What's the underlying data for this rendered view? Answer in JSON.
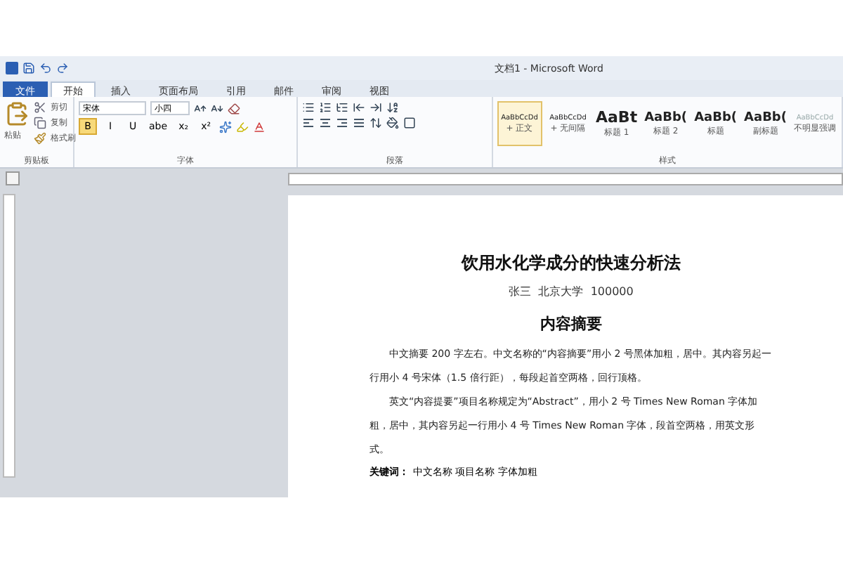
{
  "window": {
    "title": "文档1 - Microsoft Word"
  },
  "tabs": [
    {
      "label": "文件",
      "kind": "file",
      "selected": false
    },
    {
      "label": "开始",
      "kind": "tab",
      "selected": true
    },
    {
      "label": "插入",
      "kind": "tab",
      "selected": false
    },
    {
      "label": "页面布局",
      "kind": "tab",
      "selected": false
    },
    {
      "label": "引用",
      "kind": "tab",
      "selected": false
    },
    {
      "label": "邮件",
      "kind": "tab",
      "selected": false
    },
    {
      "label": "审阅",
      "kind": "tab",
      "selected": false
    },
    {
      "label": "视图",
      "kind": "tab",
      "selected": false
    }
  ],
  "clipboard": {
    "paste": "粘贴",
    "cut": "剪切",
    "copy": "复制",
    "format_painter": "格式刷",
    "group": "剪贴板"
  },
  "font": {
    "name": "宋体",
    "size": "小四",
    "group": "字体",
    "buttons": [
      {
        "label": "B",
        "selected": true
      },
      {
        "label": "I",
        "selected": false
      },
      {
        "label": "U",
        "selected": false
      },
      {
        "label": "abe",
        "selected": false
      },
      {
        "label": "x₂",
        "selected": false
      },
      {
        "label": "x²",
        "selected": false
      }
    ]
  },
  "paragraph": {
    "group": "段落"
  },
  "styles": {
    "group": "样式",
    "items": [
      {
        "sample": "AaBbCcDd",
        "label": "+ 正文",
        "kind": "small",
        "selected": true
      },
      {
        "sample": "AaBbCcDd",
        "label": "+ 无间隔",
        "kind": "small",
        "selected": false
      },
      {
        "sample": "AaBt",
        "label": "标题 1",
        "kind": "h1",
        "selected": false
      },
      {
        "sample": "AaBb(",
        "label": "标题 2",
        "kind": "h2",
        "selected": false
      },
      {
        "sample": "AaBb(",
        "label": "标题",
        "kind": "h2",
        "selected": false
      },
      {
        "sample": "AaBb(",
        "label": "副标题",
        "kind": "h2",
        "selected": false
      },
      {
        "sample": "AaBbCcDd",
        "label": "不明显强调",
        "kind": "faint",
        "selected": false
      }
    ]
  },
  "document": {
    "title": "饮用水化学成分的快速分析法",
    "author": "张三  北京大学  100000",
    "heading": "内容摘要",
    "paragraphs": [
      "中文摘要 200 字左右。中文名称的“内容摘要”用小 2 号黑体加粗，居中。其内容另起一行用小 4 号宋体（1.5 倍行距），每段起首空两格，回行顶格。",
      "英文“内容提要”项目名称规定为“Abstract”，用小 2 号 Times New Roman 字体加粗，居中，其内容另起一行用小 4 号 Times New Roman 字体，段首空两格，用英文形式。"
    ],
    "keywords_label": "关键词：",
    "keywords": "中文名称 项目名称 字体加粗"
  }
}
